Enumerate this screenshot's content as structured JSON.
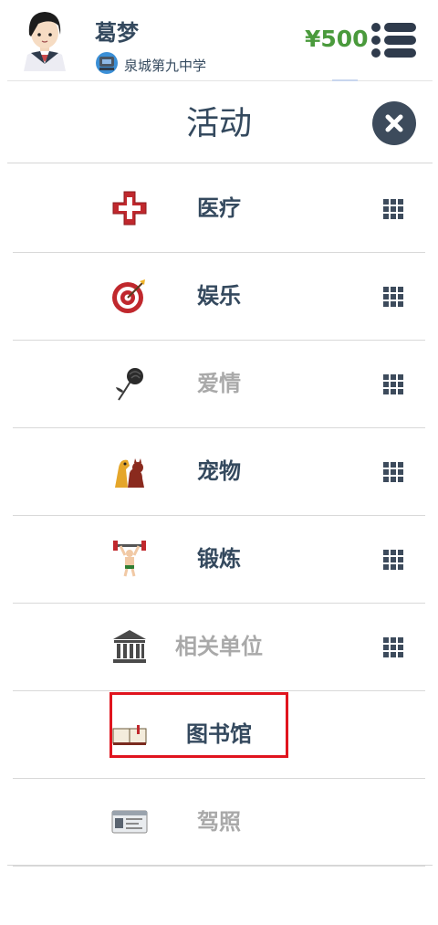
{
  "header": {
    "player_name": "葛梦",
    "school": "泉城第九中学",
    "money": "¥500",
    "menu_icon": "list-menu-icon"
  },
  "panel": {
    "title": "活动",
    "close_icon": "close-icon"
  },
  "items": [
    {
      "label": "医疗",
      "icon": "red-cross-icon",
      "has_grid": true,
      "dimmed": false
    },
    {
      "label": "娱乐",
      "icon": "target-icon",
      "has_grid": true,
      "dimmed": false
    },
    {
      "label": "爱情",
      "icon": "rose-icon",
      "has_grid": true,
      "dimmed": true
    },
    {
      "label": "宠物",
      "icon": "pets-icon",
      "has_grid": true,
      "dimmed": false
    },
    {
      "label": "锻炼",
      "icon": "weightlifter-icon",
      "has_grid": true,
      "dimmed": false
    },
    {
      "label": "相关单位",
      "icon": "building-icon",
      "has_grid": true,
      "dimmed": true
    },
    {
      "label": "图书馆",
      "icon": "book-icon",
      "has_grid": false,
      "dimmed": false,
      "highlighted": true
    },
    {
      "label": "驾照",
      "icon": "driver-license-icon",
      "has_grid": false,
      "dimmed": true
    }
  ],
  "colors": {
    "text": "#34495e",
    "dim_text": "#a9a9a9",
    "money": "#4a9a3c",
    "highlight": "#e0141e"
  }
}
